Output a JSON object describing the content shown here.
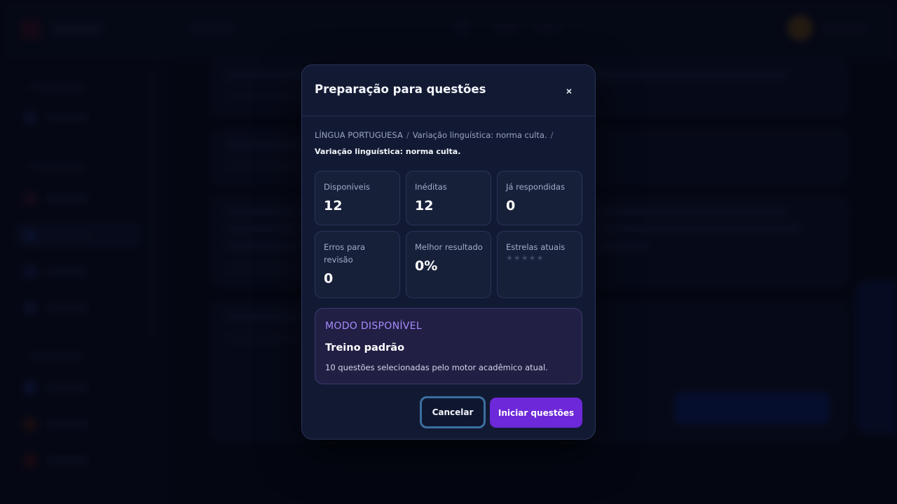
{
  "modal": {
    "title": "Preparação para questões",
    "close_label": "×",
    "breadcrumb": {
      "subject": "LÍNGUA PORTUGUESA",
      "separator": "/",
      "topic": "Variação linguística: norma culta.",
      "current": "Variação linguística: norma culta."
    },
    "stats": [
      {
        "label": "Disponíveis",
        "value": "12"
      },
      {
        "label": "Inéditas",
        "value": "12"
      },
      {
        "label": "Já respondidas",
        "value": "0"
      },
      {
        "label": "Erros para revisão",
        "value": "0"
      },
      {
        "label": "Melhor resultado",
        "value": "0%"
      },
      {
        "label": "Estrelas atuais",
        "value": "★★★★★",
        "stars_filled": 0,
        "stars_total": 5
      }
    ],
    "mode": {
      "tag": "MODO DISPONÍVEL",
      "name": "Treino padrão",
      "description": "10 questões selecionadas pelo motor acadêmico atual."
    },
    "buttons": {
      "cancel": "Cancelar",
      "start": "Iniciar questões"
    }
  },
  "colors": {
    "accent": "#6d28d9",
    "mode_tag": "#a78bfa",
    "cancel_border": "#3b6fa1",
    "modal_bg": "#121a33"
  }
}
